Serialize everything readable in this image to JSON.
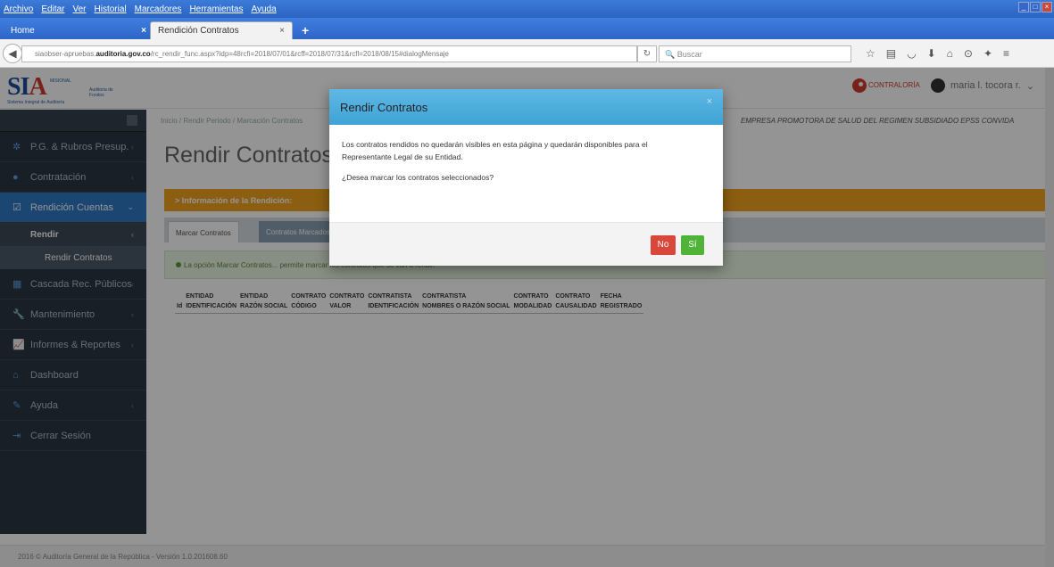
{
  "browser": {
    "menu": [
      "Archivo",
      "Editar",
      "Ver",
      "Historial",
      "Marcadores",
      "Herramientas",
      "Ayuda"
    ],
    "tabs": {
      "home": "Home",
      "active": "Rendición Contratos"
    },
    "url_prefix": "siaobser-apruebas.",
    "url_domain": "auditoria.gov.co",
    "url_rest": "/rc_rendir_func.aspx?idp=48rcfi=2018/07/01&rcff=2018/07/31&rcfl=2018/08/15#dialogMensaje",
    "search_placeholder": "Buscar"
  },
  "header": {
    "logo": "SIA",
    "logo_small": "MISIONAL",
    "logo_small2": "Auditoria de Fondos",
    "logo_sub": "Sistema Integral de Auditoría",
    "contraloria": "CONTRALORÍA",
    "user": "maria l. tocora r."
  },
  "sidebar": {
    "items": [
      {
        "label": "P.G. & Rubros Presup."
      },
      {
        "label": "Contratación"
      },
      {
        "label": "Rendición Cuentas"
      },
      {
        "label": "Cascada Rec. Públicos"
      },
      {
        "label": "Mantenimiento"
      },
      {
        "label": "Informes & Reportes"
      },
      {
        "label": "Dashboard"
      },
      {
        "label": "Ayuda"
      },
      {
        "label": "Cerrar Sesión"
      }
    ],
    "sub": "Rendir",
    "subsub": "Rendir Contratos"
  },
  "content": {
    "breadcrumb": "Inicio / Rendir Periodo / Marcación Contratos",
    "company": "EMPRESA PROMOTORA DE SALUD DEL REGIMEN SUBSIDIADO EPSS CONVIDA",
    "title": "Rendir Contratos",
    "info_bar": "> Información de la Rendición:",
    "tabs": [
      "Marcar Contratos",
      "Contratos Marcados"
    ],
    "alert": "La opción Marcar Contratos... permite marcar los contratos que se van a rendir.",
    "columns": [
      [
        "Id"
      ],
      [
        "ENTIDAD",
        "IDENTIFICACIÓN"
      ],
      [
        "ENTIDAD",
        "RAZÓN SOCIAL"
      ],
      [
        "CONTRATO",
        "CÓDIGO"
      ],
      [
        "CONTRATO",
        "VALOR"
      ],
      [
        "CONTRATISTA",
        "IDENTIFICACIÓN"
      ],
      [
        "CONTRATISTA",
        "NOMBRES O RAZÓN SOCIAL"
      ],
      [
        "CONTRATO",
        "MODALIDAD"
      ],
      [
        "CONTRATO",
        "CAUSALIDAD"
      ],
      [
        "FECHA",
        "REGISTRADO"
      ]
    ]
  },
  "footer": "2016 © Auditoría General de la República - Versión 1.0.201608.60",
  "modal": {
    "title": "Rendir Contratos",
    "close": "×",
    "message_1": "Los contratos rendidos no quedarán visibles en esta página y quedarán disponibles para el",
    "message_2": "Representante Legal de su Entidad.",
    "question": "¿Desea marcar los contratos seleccionados?",
    "no": "No",
    "si": "Sí"
  }
}
